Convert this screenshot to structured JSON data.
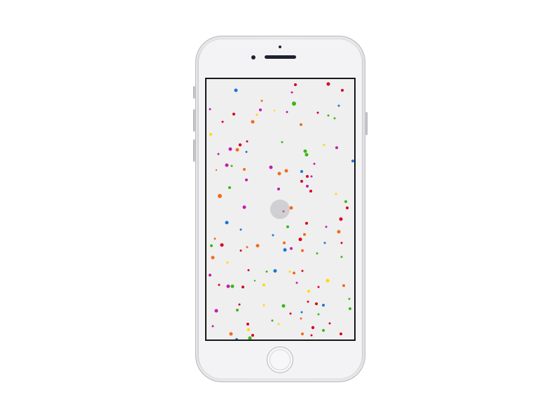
{
  "device": {
    "model": "phone",
    "finish": "silver",
    "icons": {
      "camera": "front-camera-icon",
      "speaker": "earpiece-speaker-icon",
      "home": "home-button-icon"
    }
  },
  "screen": {
    "background": "#efefef",
    "touch_indicator_color": "#a8a8ae",
    "palette": {
      "red": "#d60020",
      "blue": "#1a73d8",
      "green": "#3cb815",
      "orange": "#f26b1d",
      "magenta": "#c21bb0",
      "yellow": "#ffd800"
    }
  }
}
